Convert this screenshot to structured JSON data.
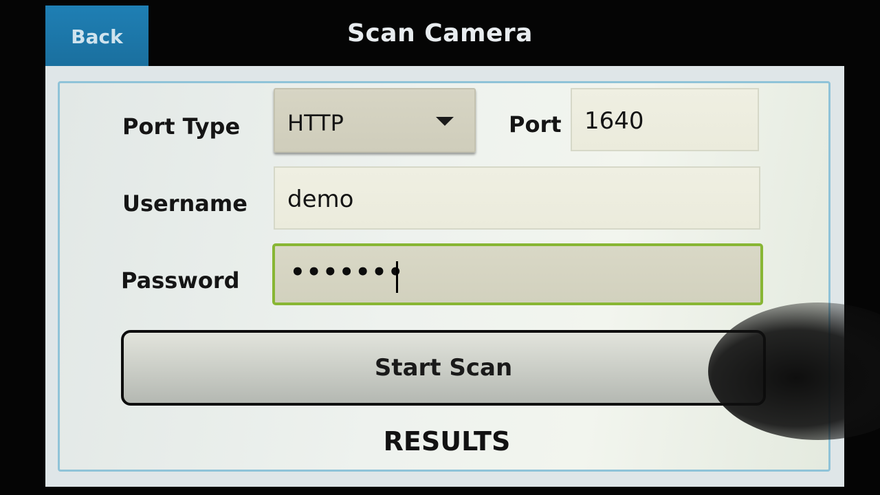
{
  "header": {
    "back_label": "Back",
    "title": "Scan Camera"
  },
  "form": {
    "port_type_label": "Port Type",
    "port_type_value": "HTTP",
    "port_label": "Port",
    "port_value": "1640",
    "username_label": "Username",
    "username_value": "demo",
    "password_label": "Password",
    "password_mask": "•••••••"
  },
  "actions": {
    "start_scan_label": "Start Scan"
  },
  "results": {
    "heading": "RESULTS"
  },
  "colors": {
    "back_button": "#1f7fb4",
    "focus_border": "#88b634",
    "panel_border": "#8fc3d8"
  }
}
